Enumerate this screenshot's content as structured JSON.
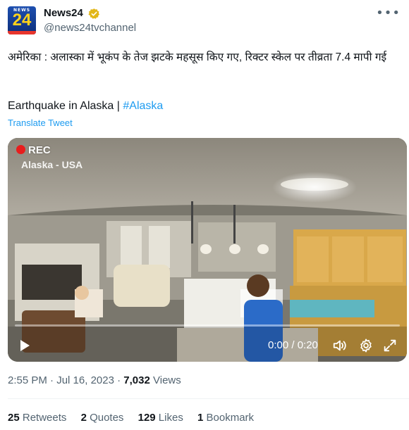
{
  "author": {
    "display_name": "News24",
    "handle": "@news24tvchannel",
    "avatar_text_small": "NEWS",
    "avatar_text_big": "24"
  },
  "tweet": {
    "text_hindi": "अमेरिका : अलास्का में भूकंप के तेज झटके महसूस किए गए, रिक्टर स्केल पर तीव्रता 7.4 मापी गई",
    "text_english": "Earthquake in Alaska | ",
    "hashtag": "#Alaska",
    "translate_label": "Translate Tweet"
  },
  "video": {
    "rec_label": "REC",
    "location_label": "Alaska - USA",
    "time_display": "0:00 / 0:20",
    "progress": 0
  },
  "meta": {
    "time": "2:55 PM",
    "separator": " · ",
    "date": "Jul 16, 2023",
    "views_count": "7,032",
    "views_label": " Views"
  },
  "stats": [
    {
      "count": "25",
      "label": " Retweets"
    },
    {
      "count": "2",
      "label": " Quotes"
    },
    {
      "count": "129",
      "label": " Likes"
    },
    {
      "count": "1",
      "label": " Bookmark"
    }
  ],
  "icons": [
    "verified-badge-icon",
    "more-icon",
    "play-icon",
    "volume-icon",
    "settings-icon",
    "fullscreen-icon"
  ],
  "colors": {
    "accent": "#1d9bf0",
    "verified": "#e2b719",
    "rec": "#e81d1d"
  }
}
